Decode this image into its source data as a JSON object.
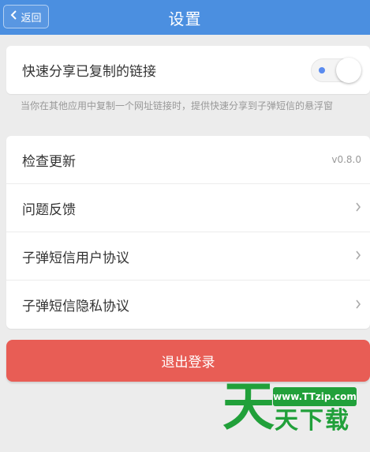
{
  "header": {
    "title": "设置",
    "back_label": "返回"
  },
  "share": {
    "label": "快速分享已复制的链接",
    "toggle_on": false,
    "hint": "当你在其他应用中复制一个网址链接时，提供快速分享到子弹短信的悬浮窗"
  },
  "menu": {
    "items": [
      {
        "label": "检查更新",
        "value": "v0.8.0"
      },
      {
        "label": "问题反馈"
      },
      {
        "label": "子弹短信用户协议"
      },
      {
        "label": "子弹短信隐私协议"
      }
    ]
  },
  "logout_label": "退出登录",
  "watermark": {
    "char": "天",
    "url": "www.TTzip.com",
    "text": "天下载"
  },
  "colors": {
    "header": "#4b8fe0",
    "logout": "#e85d55",
    "watermark": "#21a03a"
  }
}
